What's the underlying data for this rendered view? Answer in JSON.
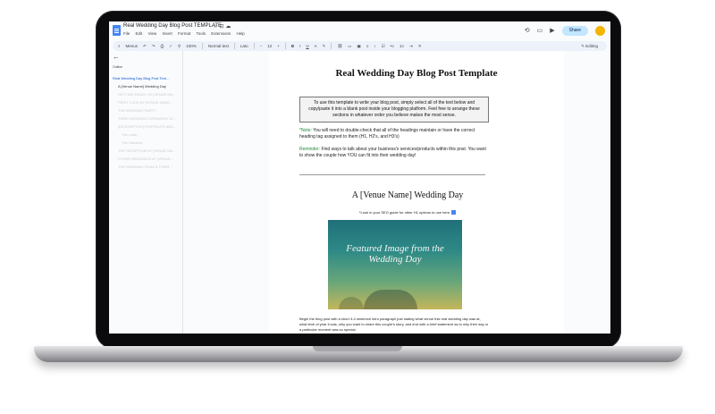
{
  "app": {
    "doc_title": "Real Wedding Day Blog Post TEMPLATE",
    "menu": [
      "File",
      "Edit",
      "View",
      "Insert",
      "Format",
      "Tools",
      "Extensions",
      "Help"
    ],
    "share_label": "Share"
  },
  "toolbar": {
    "menus": "Menus",
    "zoom": "100%",
    "style": "Normal text",
    "font": "Lato",
    "size": "12",
    "bold": "B",
    "italic": "I",
    "underline": "U",
    "text_color": "A",
    "mode": "Editing"
  },
  "sidebar": {
    "label": "Outline",
    "items": [
      "Real Wedding Day Blog Post Tem...",
      "A [Venue Name] Wedding Day",
      "GETTING READY AT [VENUE NA...",
      "FIRST LOOK AT [VENUE NAME...",
      "THE WEDDING PARTY",
      "THEIR WEDDING CEREMONY AT...",
      "[DESCRIPTIVE] PORTRAITS AND...",
      "The Lawn",
      "The Gardens",
      "THE RECEPTION AT [VENUE NA...",
      "OTHER WEDDINGS AT [VENUE...",
      "THE WEDDING TEAM & THEIR..."
    ]
  },
  "document": {
    "title": "Real Wedding Day Blog Post Template",
    "info_box": "To use this template to write your blog post, simply select all of the text below and copy/paste it into a blank post inside your blogging platform. Feel free to arrange these sections in whatever order you believe makes the most sense.",
    "note_label": "*Note:",
    "note_text": " You will need to double-check that all of the headings maintain or have the correct heading tag assigned to them (H1, H2's, and H3's)",
    "reminder_label": "Reminder:",
    "reminder_text": " Find ways to talk about your business's services/products within this post. You want to show the couple how YOU can fit into their wedding day!",
    "venue_heading": "A [Venue Name] Wedding Day",
    "seo_note": "*Look in your SEO guide for other H1 options to use here",
    "featured_image_text": "Featured Image from the Wedding Day",
    "intro_paragraph": "Begin the blog post with a short 3-4 sentence intro paragraph just stating what venue this real wedding day was at, what time of year it was, why you want to share this couple's story, and end with a brief statement as to why their day or a particular moment was so special."
  },
  "colors": {
    "accent": "#0b57d0",
    "share_bg": "#c2e7ff",
    "note_green": "#1e8a3a"
  }
}
